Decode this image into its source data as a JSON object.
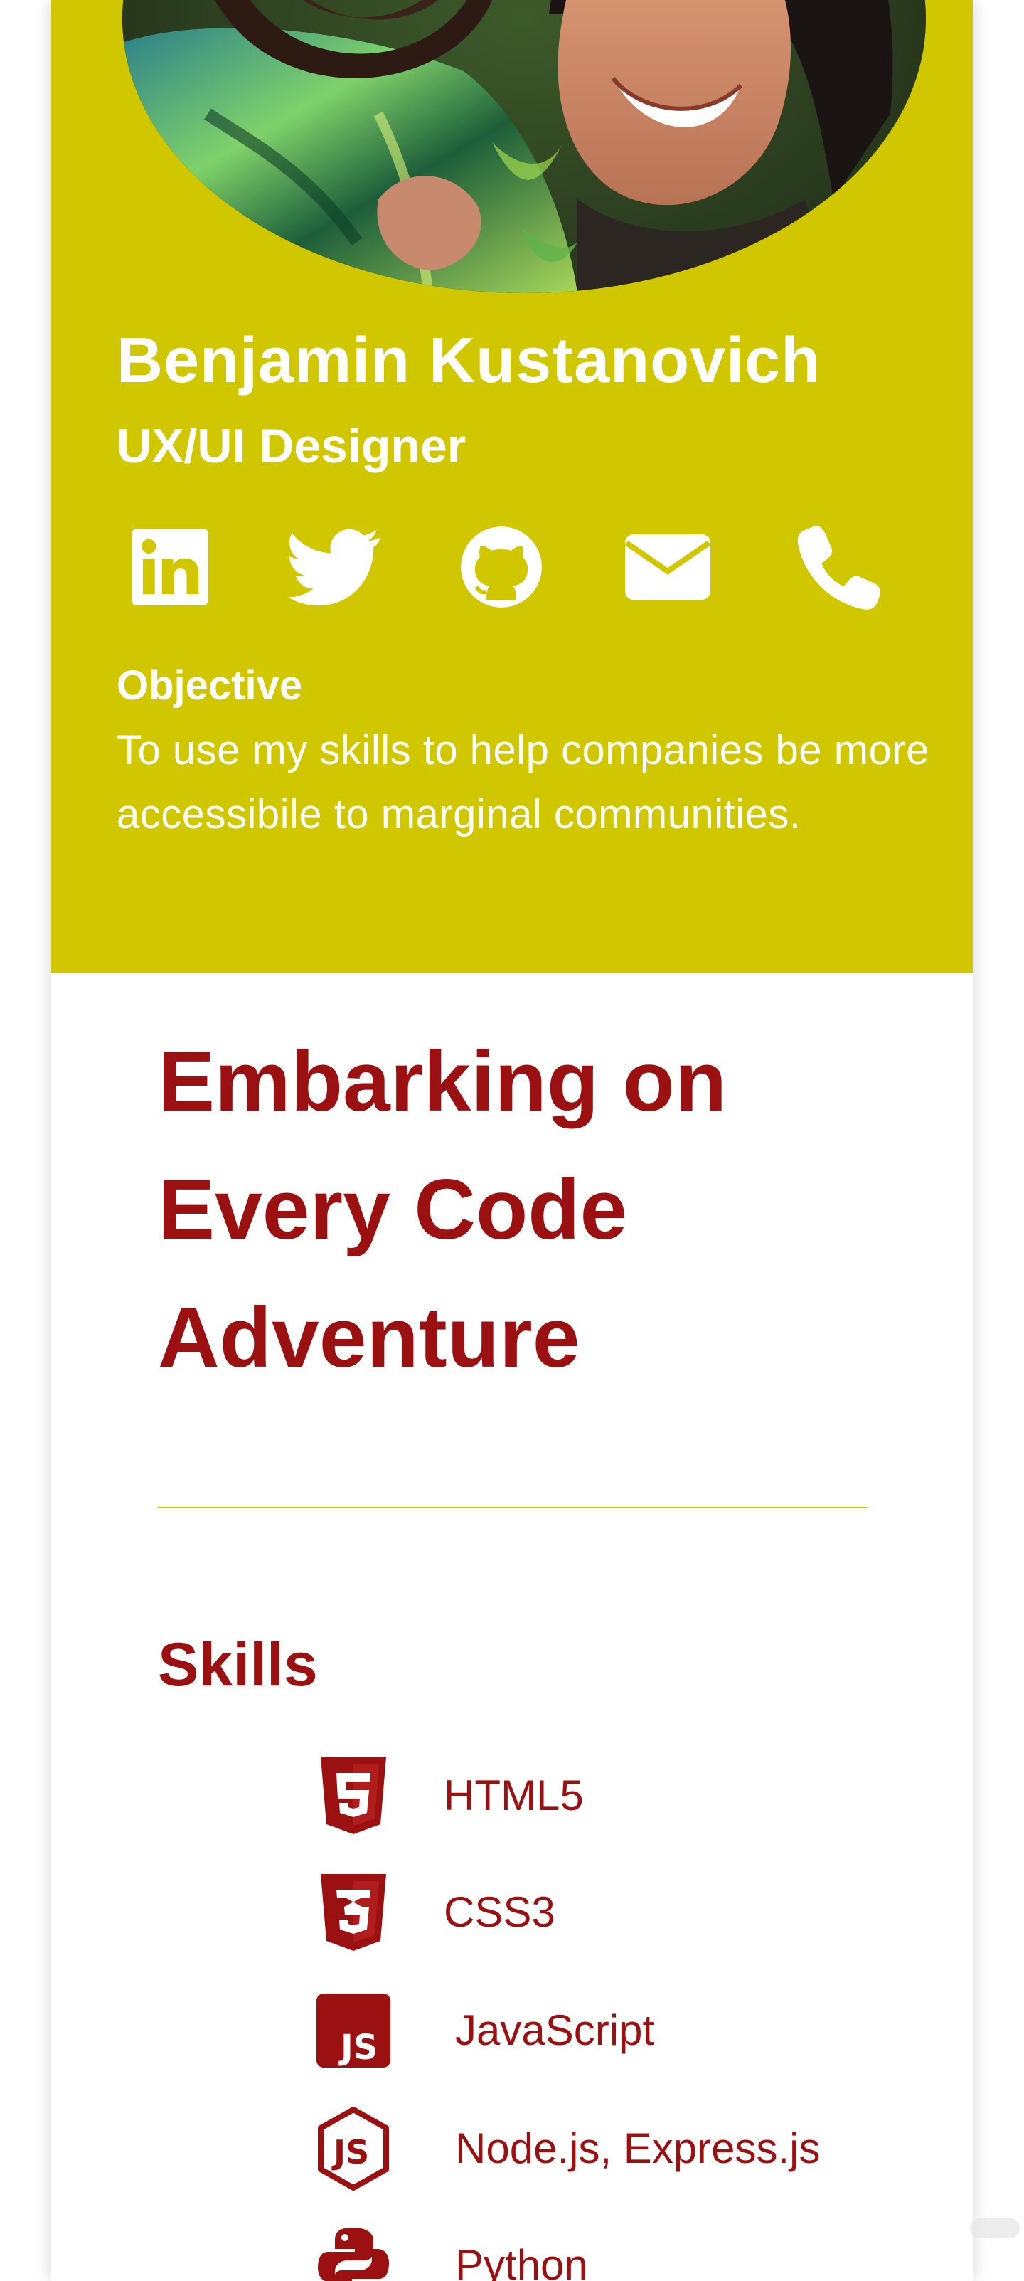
{
  "profile": {
    "name": "Benjamin Kustanovich",
    "role": "UX/UI Designer",
    "social": [
      {
        "name": "linkedin-icon",
        "label": "LinkedIn"
      },
      {
        "name": "twitter-icon",
        "label": "Twitter"
      },
      {
        "name": "github-icon",
        "label": "GitHub"
      },
      {
        "name": "envelope-icon",
        "label": "Email"
      },
      {
        "name": "phone-icon",
        "label": "Phone"
      }
    ],
    "objective_title": "Objective",
    "objective_text": "To use my skills to help companies be more accessibile to marginal communities."
  },
  "hero": {
    "headline": "Embarking on Every Code Adventure"
  },
  "skills": {
    "title": "Skills",
    "items": [
      {
        "icon": "html5-icon",
        "label": "HTML5"
      },
      {
        "icon": "css3-icon",
        "label": "CSS3"
      },
      {
        "icon": "javascript-icon",
        "label": "JavaScript"
      },
      {
        "icon": "nodejs-icon",
        "label": "Node.js, Express.js"
      },
      {
        "icon": "python-icon",
        "label": "Python"
      }
    ]
  },
  "colors": {
    "header_yellow": "#d1c700",
    "accent_red": "#9b1111",
    "text_white": "#ffffff"
  }
}
